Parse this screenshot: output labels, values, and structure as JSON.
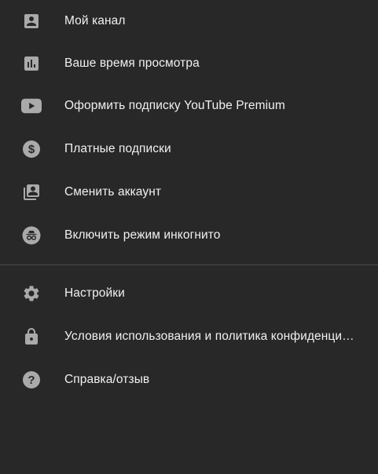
{
  "colors": {
    "background": "#282828",
    "icon": "#aaaaaa",
    "text": "#f1f1f1",
    "divider": "#4a4a4a"
  },
  "menu": {
    "primary_items": [
      {
        "icon": "account-box-icon",
        "label": "Мой канал"
      },
      {
        "icon": "bar-chart-icon",
        "label": "Ваше время просмотра"
      },
      {
        "icon": "youtube-play-icon",
        "label": "Оформить подписку YouTube Premium"
      },
      {
        "icon": "dollar-circle-icon",
        "label": "Платные подписки"
      },
      {
        "icon": "switch-account-icon",
        "label": "Сменить аккаунт"
      },
      {
        "icon": "incognito-icon",
        "label": "Включить режим инкогнито"
      }
    ],
    "secondary_items": [
      {
        "icon": "gear-icon",
        "label": "Настройки"
      },
      {
        "icon": "lock-icon",
        "label": "Условия использования и политика конфиденциальности"
      },
      {
        "icon": "help-circle-icon",
        "label": "Справка/отзыв"
      }
    ]
  }
}
